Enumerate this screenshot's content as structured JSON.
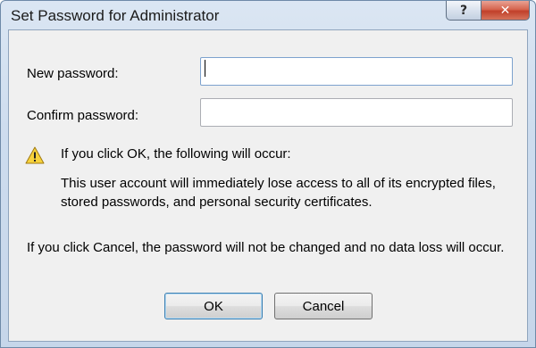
{
  "window": {
    "title": "Set Password for Administrator",
    "help_glyph": "?",
    "close_glyph": "✕",
    "help_icon": "question-mark-icon",
    "close_icon": "close-icon"
  },
  "form": {
    "new_password_label": "New password:",
    "new_password_value": "",
    "confirm_password_label": "Confirm password:",
    "confirm_password_value": ""
  },
  "warning": {
    "icon": "warning-icon",
    "heading": "If you click OK, the following will occur:",
    "detail": "This user account will immediately lose access to all of its encrypted files, stored passwords, and personal security certificates."
  },
  "cancel_note": "If you click Cancel, the password will not be changed and no data loss will occur.",
  "buttons": {
    "ok_label": "OK",
    "cancel_label": "Cancel"
  },
  "colors": {
    "warning_yellow": "#f7d23c",
    "close_red": "#c1402a",
    "default_button_border": "#3c7fb1"
  }
}
